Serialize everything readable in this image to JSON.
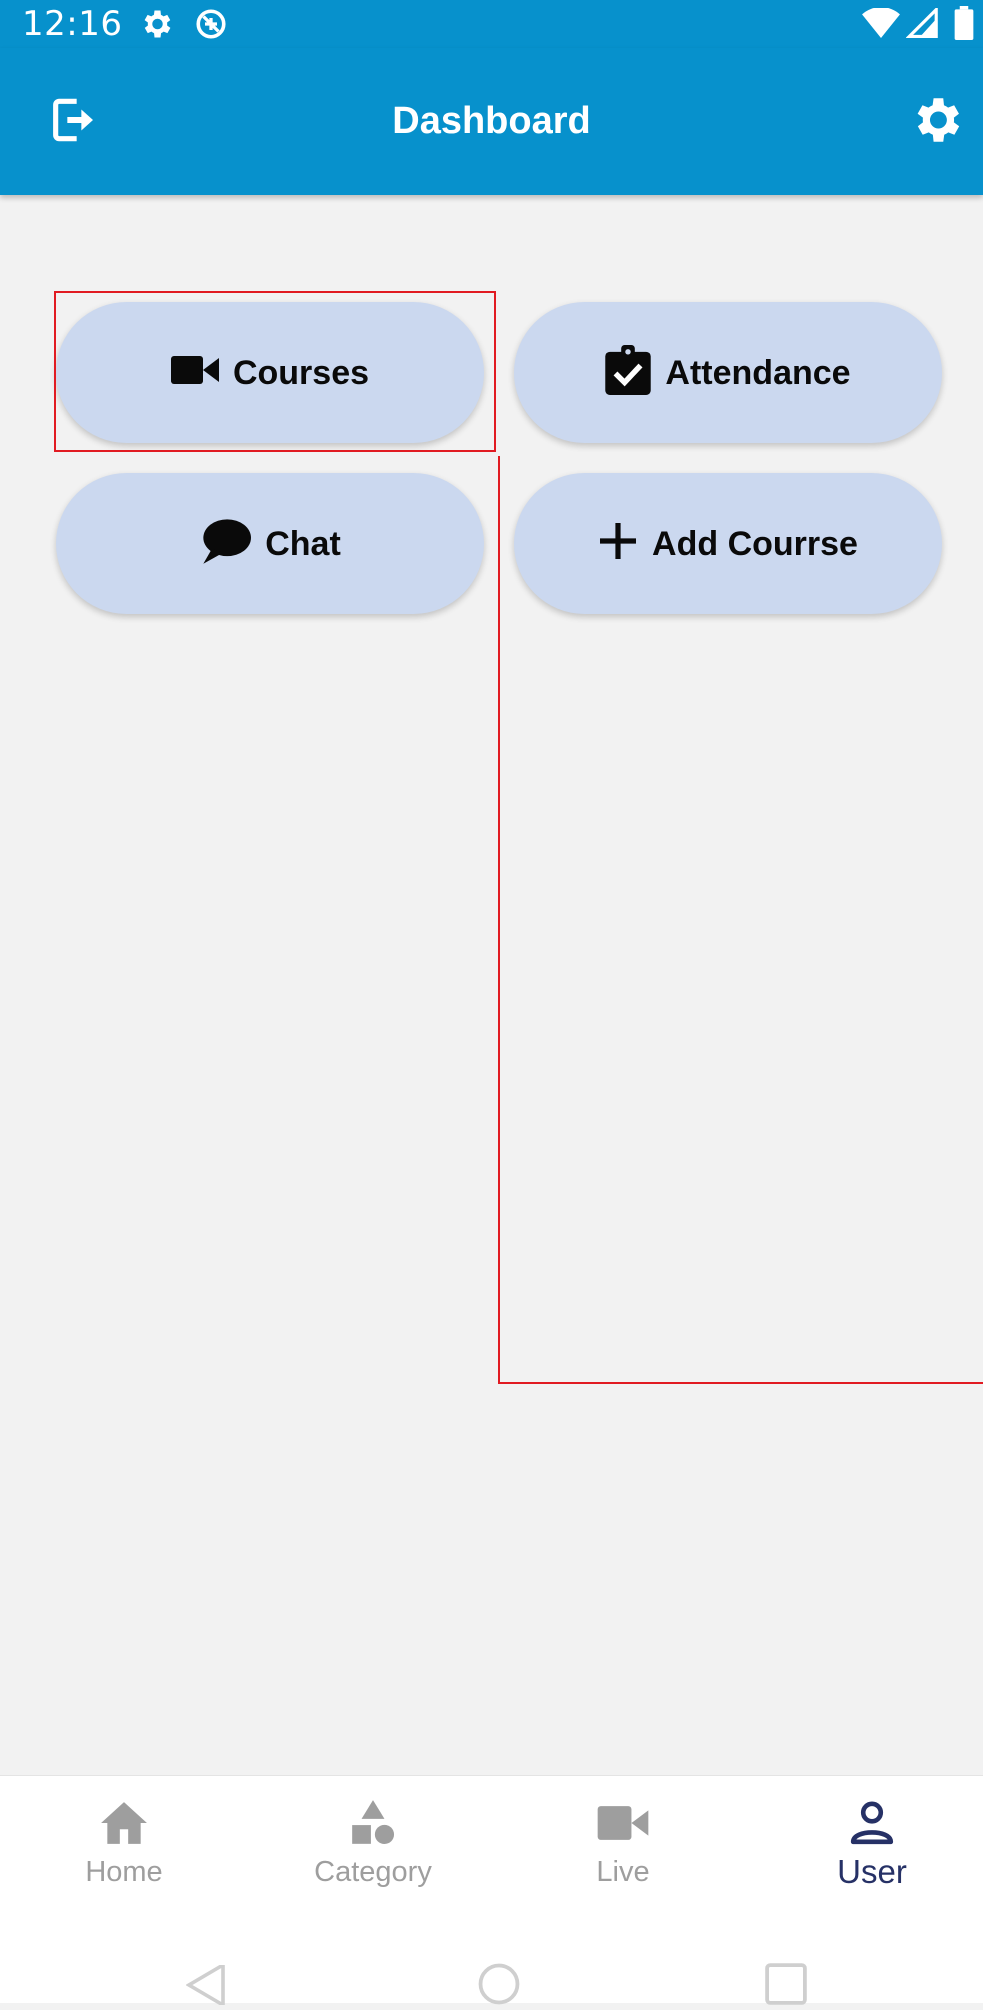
{
  "status_bar": {
    "time": "12:16",
    "icons": [
      "settings-icon",
      "data-saver-icon",
      "wifi-icon",
      "signal-icon",
      "battery-icon"
    ]
  },
  "app_bar": {
    "title": "Dashboard",
    "left_icon": "logout-icon",
    "right_icon": "settings-icon",
    "color": "#0791cc"
  },
  "tiles": [
    {
      "label": "Courses",
      "icon": "video-camera-icon"
    },
    {
      "label": "Attendance",
      "icon": "clipboard-check-icon"
    },
    {
      "label": "Chat",
      "icon": "chat-bubble-icon"
    },
    {
      "label": "Add Courrse",
      "icon": "plus-icon"
    }
  ],
  "bottom_nav": {
    "items": [
      {
        "label": "Home",
        "icon": "home-icon",
        "active": false
      },
      {
        "label": "Category",
        "icon": "category-icon",
        "active": false
      },
      {
        "label": "Live",
        "icon": "video-camera-icon",
        "active": false
      },
      {
        "label": "User",
        "icon": "user-icon",
        "active": true
      }
    ],
    "active_color": "#263166",
    "inactive_color": "#9e9e9e"
  },
  "system_nav": {
    "buttons": [
      "back-icon",
      "home-circle-icon",
      "recents-icon"
    ]
  },
  "colors": {
    "background": "#f2f2f2",
    "tile": "#cbd8ef",
    "highlight": "#e11b22"
  }
}
